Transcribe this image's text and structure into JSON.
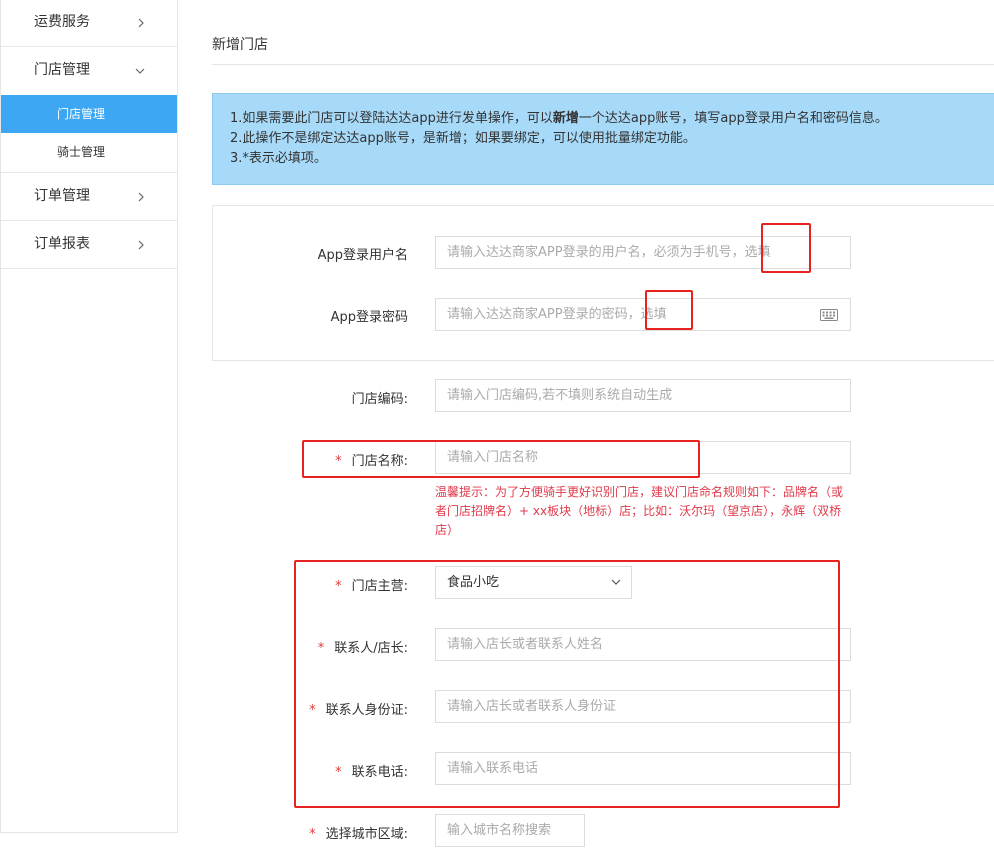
{
  "sidebar": {
    "items": [
      {
        "label": "运费服务"
      },
      {
        "label": "门店管理",
        "sub": [
          "门店管理",
          "骑士管理"
        ]
      },
      {
        "label": "订单管理"
      },
      {
        "label": "订单报表"
      }
    ]
  },
  "page": {
    "title": "新增门店"
  },
  "notice": {
    "line1_a": "1.如果需要此门店可以登陆达达app进行发单操作，可以",
    "line1_b": "新增",
    "line1_c": "一个达达app账号，填写app登录用户名和密码信息。",
    "line2": "2.此操作不是绑定达达app账号，是新增；如果要绑定，可以使用批量绑定功能。",
    "line3": "3.*表示必填项。"
  },
  "form": {
    "app_user": {
      "label": "App登录用户名",
      "placeholder": "请输入达达商家APP登录的用户名，必须为手机号，选填"
    },
    "app_pass": {
      "label": "App登录密码",
      "placeholder": "请输入达达商家APP登录的密码，选填"
    },
    "store_code": {
      "label": "门店编码:",
      "placeholder": "请输入门店编码,若不填则系统自动生成"
    },
    "store_name": {
      "star": "*",
      "label": "门店名称:",
      "placeholder": "请输入门店名称"
    },
    "tip": "温馨提示：为了方便骑手更好识别门店，建议门店命名规则如下：品牌名（或者门店招牌名）+ xx板块（地标）店；比如：沃尔玛（望京店），永辉（双桥店）",
    "category": {
      "star": "*",
      "label": "门店主营:",
      "value": "食品小吃"
    },
    "contact": {
      "star": "*",
      "label": "联系人/店长:",
      "placeholder": "请输入店长或者联系人姓名"
    },
    "id_card": {
      "star": "*",
      "label": "联系人身份证:",
      "placeholder": "请输入店长或者联系人身份证"
    },
    "phone": {
      "star": "*",
      "label": "联系电话:",
      "placeholder": "请输入联系电话"
    },
    "city": {
      "star": "*",
      "label": "选择城市区域:",
      "placeholder": "输入城市名称搜索"
    }
  },
  "colors": {
    "active": "#3ea7f4",
    "notice_bg": "#a7d9f8",
    "highlight": "#e8221f",
    "required": "#e23b3b"
  },
  "icons": [
    "chevron-right-icon",
    "chevron-down-icon",
    "keyboard-icon"
  ]
}
